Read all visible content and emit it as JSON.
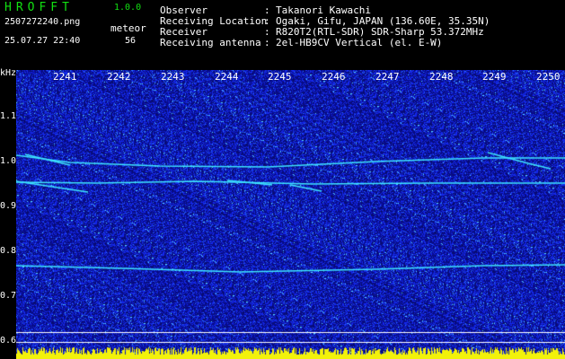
{
  "header": {
    "app_name": "HROFFT",
    "version": "1.0.0",
    "filename": "2507272240.png",
    "timestamp": "25.07.27 22:40",
    "mode_label": "meteor",
    "count": "56",
    "info": [
      {
        "label": "Observer",
        "value": "Takanori Kawachi"
      },
      {
        "label": "Receiving Location",
        "value": "Ogaki, Gifu, JAPAN (136.60E, 35.35N)"
      },
      {
        "label": "Receiver",
        "value": "R820T2(RTL-SDR) SDR-Sharp 53.372MHz"
      },
      {
        "label": "Receiving antenna",
        "value": "2el-HB9CV Vertical (el. E-W)"
      }
    ],
    "colon": ":"
  },
  "axes": {
    "y_unit": "kHz",
    "y_ticks": [
      "1.1",
      "1.0",
      "0.9",
      "0.8",
      "0.7",
      "0.6"
    ],
    "x_ticks": [
      "2241",
      "2242",
      "2243",
      "2244",
      "2245",
      "2246",
      "2247",
      "2248",
      "2249",
      "2250"
    ]
  },
  "colors": {
    "background": "#000000",
    "noise": "#1a2ad8",
    "trace": "#3ee6ff",
    "marker": "#ffffff",
    "bottom_bars": "#f2f20a"
  }
}
